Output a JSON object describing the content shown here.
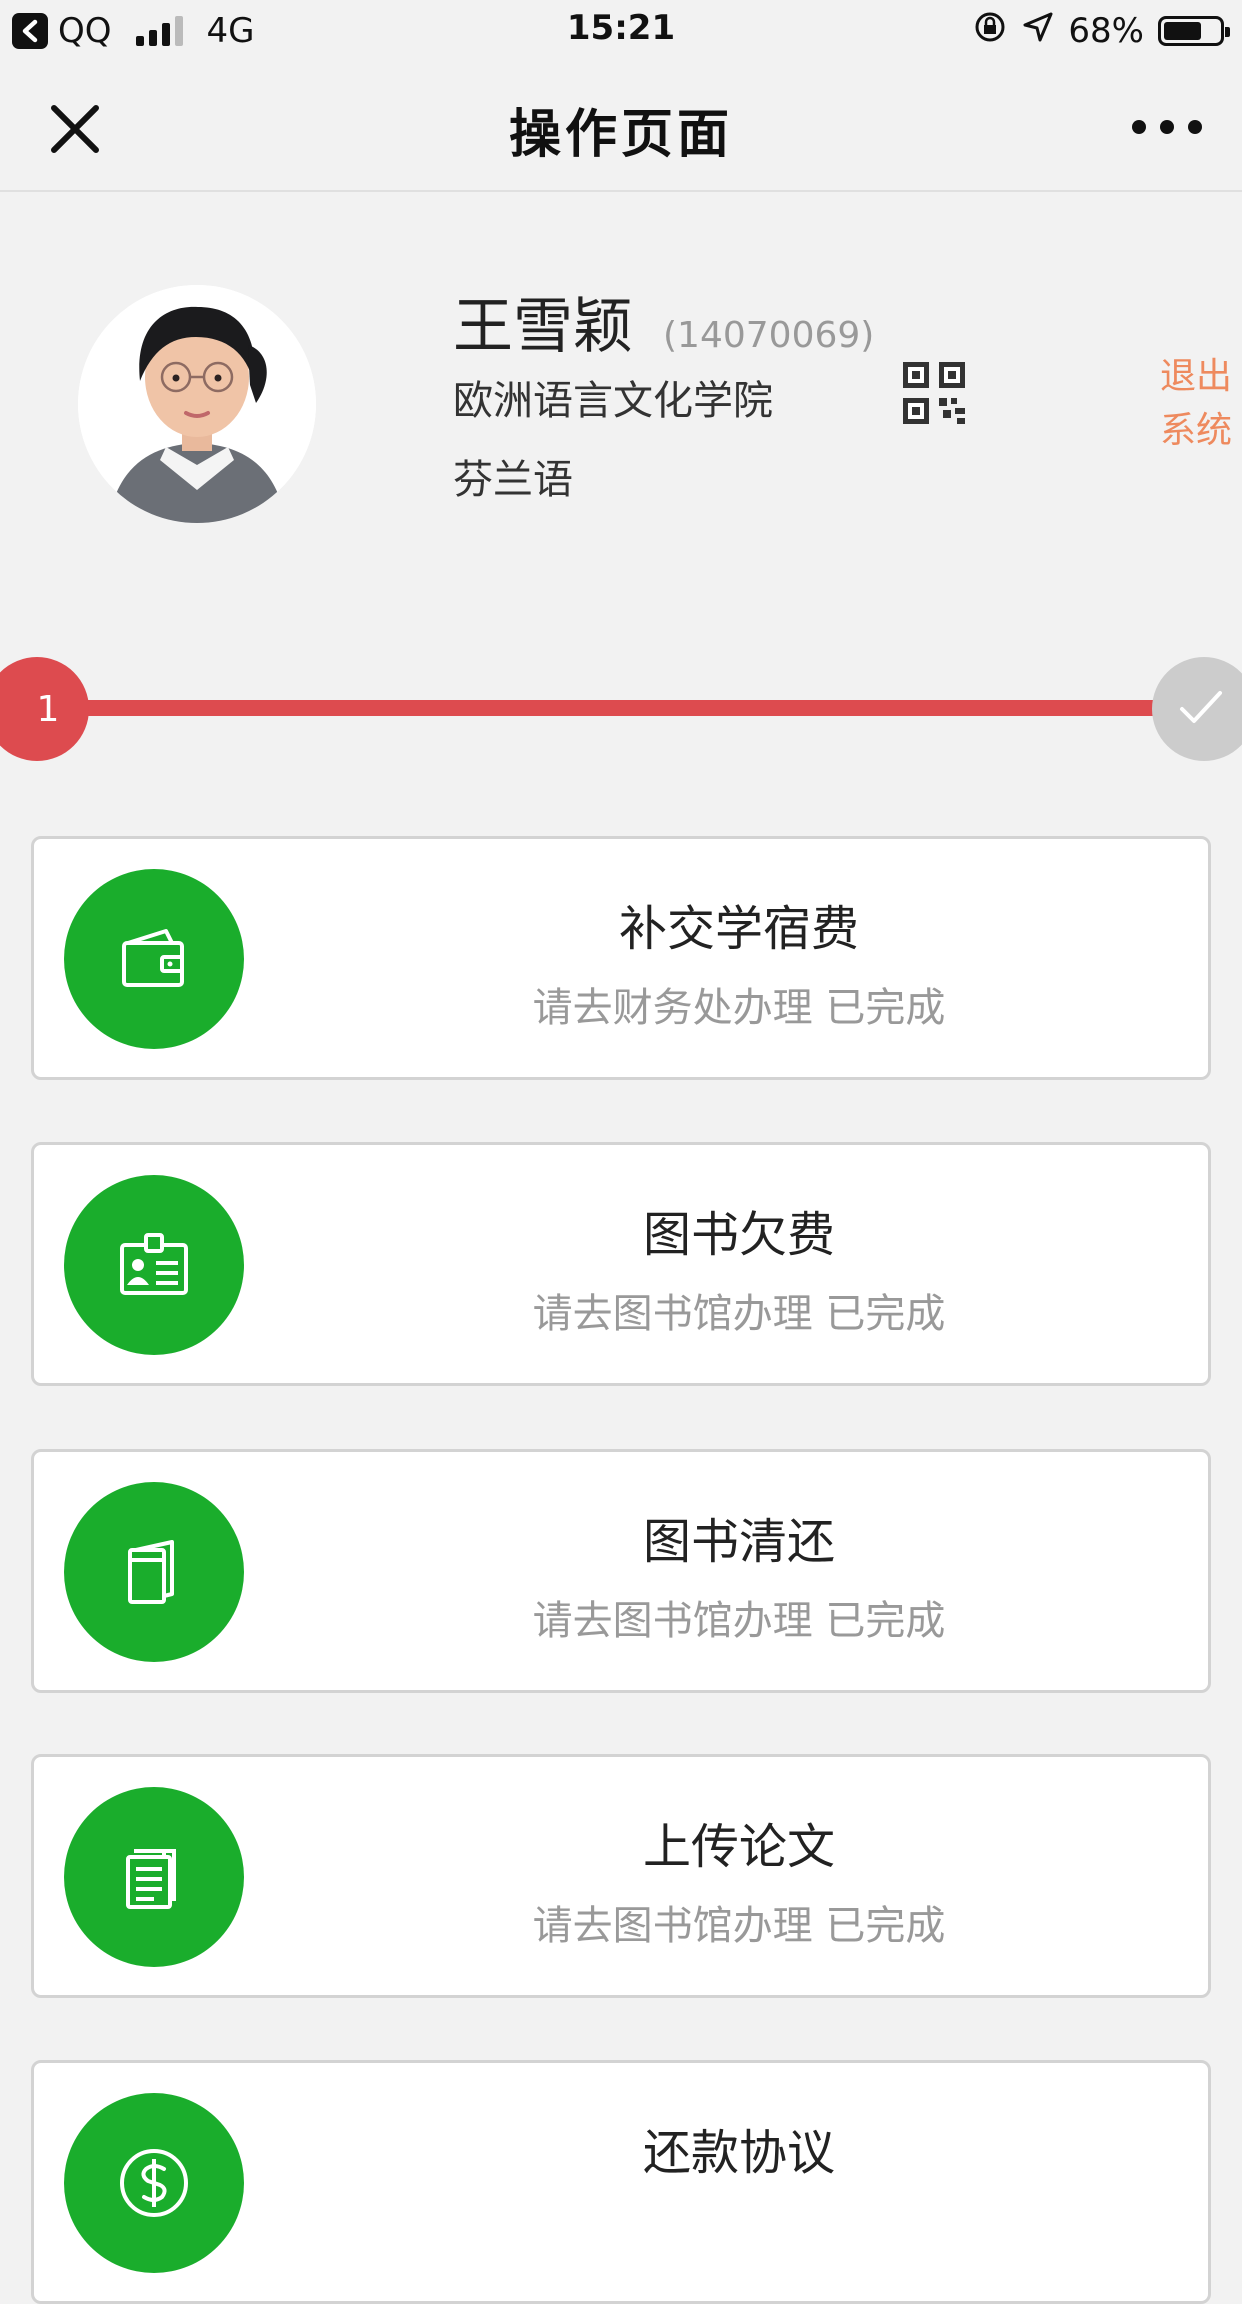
{
  "status_bar": {
    "carrier": "QQ",
    "network": "4G",
    "time": "15:21",
    "battery": "68%",
    "battery_level": 0.68,
    "icons": [
      "back-to-app-icon",
      "signal-icon",
      "rotation-lock-icon",
      "location-icon",
      "battery-icon"
    ]
  },
  "nav": {
    "title": "操作页面",
    "close_icon": "close-icon",
    "more_icon": "more-icon"
  },
  "profile": {
    "name": "王雪颖",
    "student_id": "(14070069)",
    "college": "欧洲语言文化学院",
    "major": "芬兰语",
    "qr_icon": "qr-code-icon",
    "logout": "退出系统"
  },
  "progress": {
    "current_step": "1",
    "end_icon": "checkmark-icon",
    "colors": {
      "active": "#dd4b4f",
      "inactive": "#cccccc"
    }
  },
  "tasks": [
    {
      "title": "补交学宿费",
      "subtitle": "请去财务处办理 已完成",
      "icon": "wallet-icon"
    },
    {
      "title": "图书欠费",
      "subtitle": "请去图书馆办理 已完成",
      "icon": "id-card-icon"
    },
    {
      "title": "图书清还",
      "subtitle": "请去图书馆办理 已完成",
      "icon": "book-icon"
    },
    {
      "title": "上传论文",
      "subtitle": "请去图书馆办理 已完成",
      "icon": "document-icon"
    },
    {
      "title": "还款协议",
      "subtitle": "",
      "icon": "dollar-coin-icon"
    }
  ],
  "colors": {
    "accent_green": "#1aad2c",
    "logout_orange": "#ee8a5e",
    "background": "#f2f2f2"
  }
}
